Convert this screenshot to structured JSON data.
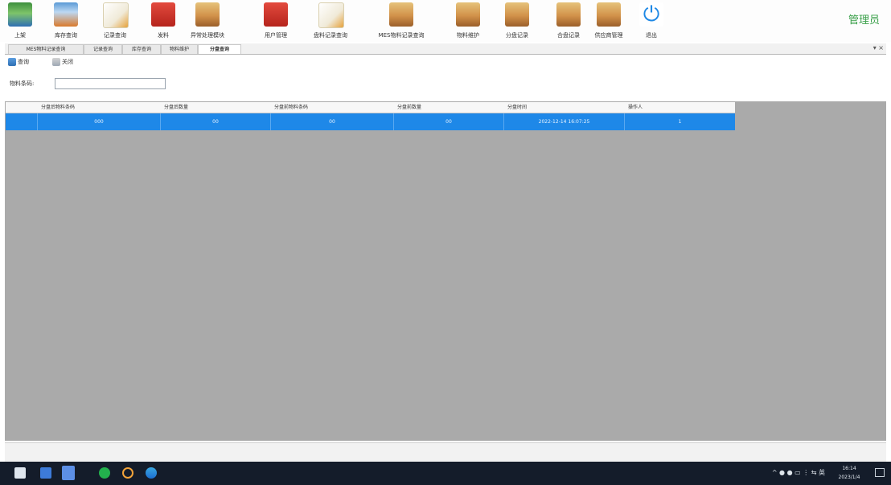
{
  "toolbar": {
    "buttons": [
      {
        "label": "上架",
        "icon": "shelf-icon"
      },
      {
        "label": "库存查询",
        "icon": "warehouse-icon"
      },
      {
        "label": "记录查询",
        "icon": "notepad-icon"
      },
      {
        "label": "发料",
        "icon": "issue-icon"
      },
      {
        "label": "异常处理模块",
        "icon": "box-icon"
      },
      {
        "label": "用户管理",
        "icon": "user-icon"
      },
      {
        "label": "盘料记录查询",
        "icon": "notepad-icon"
      },
      {
        "label": "MES物料记录查询",
        "icon": "box-icon"
      },
      {
        "label": "物料维护",
        "icon": "box-icon"
      },
      {
        "label": "分盘记录",
        "icon": "box-icon"
      },
      {
        "label": "合盘记录",
        "icon": "box-icon"
      },
      {
        "label": "供应商管理",
        "icon": "box-icon"
      },
      {
        "label": "退出",
        "icon": "power-icon"
      }
    ],
    "user_label": "管理员"
  },
  "tabs": [
    {
      "label": "MES物料记录查询",
      "active": false
    },
    {
      "label": "记录查询",
      "active": false
    },
    {
      "label": "库存查询",
      "active": false
    },
    {
      "label": "物料维护",
      "active": false
    },
    {
      "label": "分盘查询",
      "active": true
    }
  ],
  "tab_controls": "▾ ×",
  "actions": {
    "search_label": "查询",
    "close_label": "关闭"
  },
  "search": {
    "label": "物料条码:",
    "value": "",
    "placeholder": ""
  },
  "table": {
    "columns": [
      "分盘后物料条码",
      "分盘后数量",
      "分盘前物料条码",
      "分盘前数量",
      "分盘时间",
      "操作人"
    ],
    "rows": [
      {
        "selected": true,
        "cells": [
          "000",
          "00",
          "00",
          "00",
          "2022-12-14 16:07:25",
          "1"
        ]
      }
    ]
  },
  "taskbar": {
    "tray_icons": "^ ● ● ▭ ⋮ ⇆ 英",
    "time": "16:14",
    "date": "2023/1/4"
  },
  "colors": {
    "selection": "#1e88e8",
    "grid_background": "#aaaaaa",
    "admin_text": "#3aa04a",
    "taskbar": "#141c2a"
  }
}
